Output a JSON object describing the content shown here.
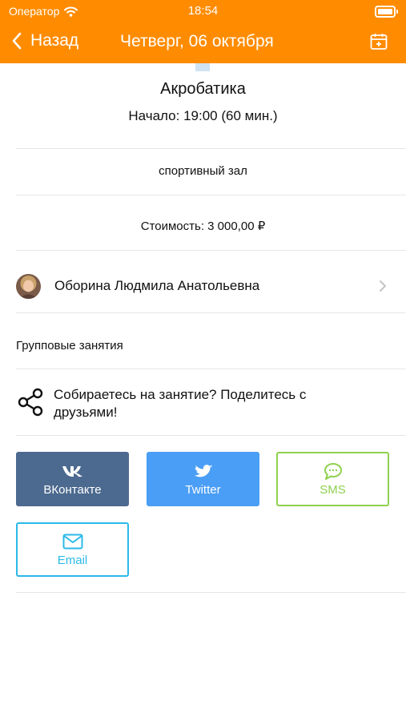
{
  "status_bar": {
    "carrier": "Оператор",
    "time": "18:54"
  },
  "nav": {
    "back_label": "Назад",
    "title": "Четверг, 06 октября",
    "calendar_icon": "calendar-add-icon"
  },
  "class": {
    "title": "Акробатика",
    "start": "Начало: 19:00 (60 мин.)",
    "room": "спортивный зал",
    "price": "Стоимость: 3 000,00 ₽",
    "category": "Групповые занятия"
  },
  "trainer": {
    "name": "Оборина Людмила Анатольевна"
  },
  "share": {
    "prompt": "Собираетесь на занятие? Поделитесь с друзьями!",
    "buttons": [
      {
        "label": "ВКонтакте",
        "icon": "vk-icon",
        "color": "#4C6A8F"
      },
      {
        "label": "Twitter",
        "icon": "twitter-icon",
        "color": "#4A9EF5"
      },
      {
        "label": "SMS",
        "icon": "sms-icon",
        "color": "#8FD14F"
      },
      {
        "label": "Email",
        "icon": "email-icon",
        "color": "#2BB9E8"
      }
    ]
  },
  "colors": {
    "accent": "#FF8C00"
  }
}
